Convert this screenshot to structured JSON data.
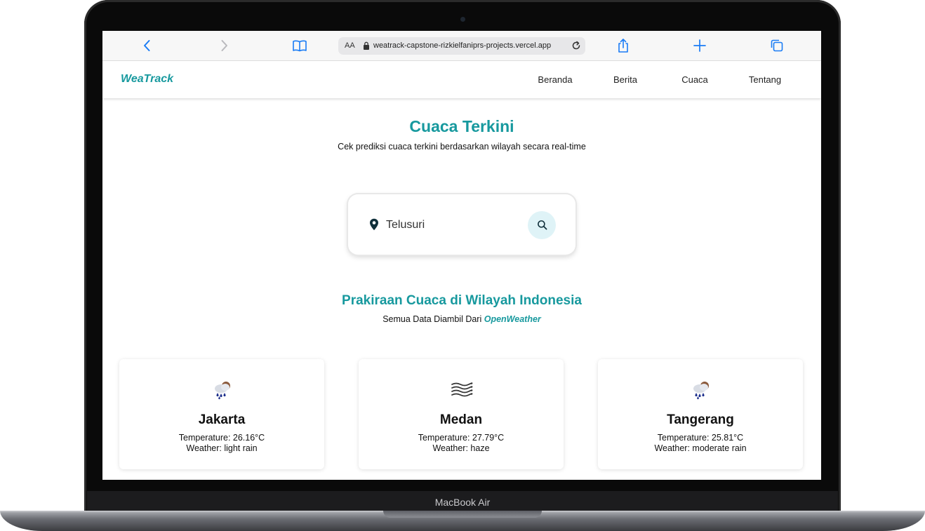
{
  "device": {
    "label": "MacBook Air"
  },
  "browser": {
    "text_size_label": "AA",
    "url": "weatrack-capstone-rizkielfaniprs-projects.vercel.app"
  },
  "site": {
    "brand": "WeaTrack",
    "nav": [
      "Beranda",
      "Berita",
      "Cuaca",
      "Tentang"
    ]
  },
  "hero": {
    "title": "Cuaca Terkini",
    "subtitle": "Cek prediksi cuaca terkini berdasarkan wilayah secara real-time"
  },
  "search": {
    "placeholder": "Telusuri",
    "value": ""
  },
  "forecast": {
    "title": "Prakiraan Cuaca di Wilayah Indonesia",
    "source_prefix": "Semua Data Diambil Dari",
    "source_link": "OpenWeather",
    "cards": [
      {
        "city": "Jakarta",
        "temperature": "Temperature: 26.16°C",
        "weather": "Weather: light rain",
        "icon": "rain-cloud-icon"
      },
      {
        "city": "Medan",
        "temperature": "Temperature: 27.79°C",
        "weather": "Weather: haze",
        "icon": "haze-icon"
      },
      {
        "city": "Tangerang",
        "temperature": "Temperature: 25.81°C",
        "weather": "Weather: moderate rain",
        "icon": "rain-cloud-icon"
      }
    ]
  },
  "colors": {
    "accent": "#17999e",
    "browser_blue": "#1a7cf5"
  }
}
